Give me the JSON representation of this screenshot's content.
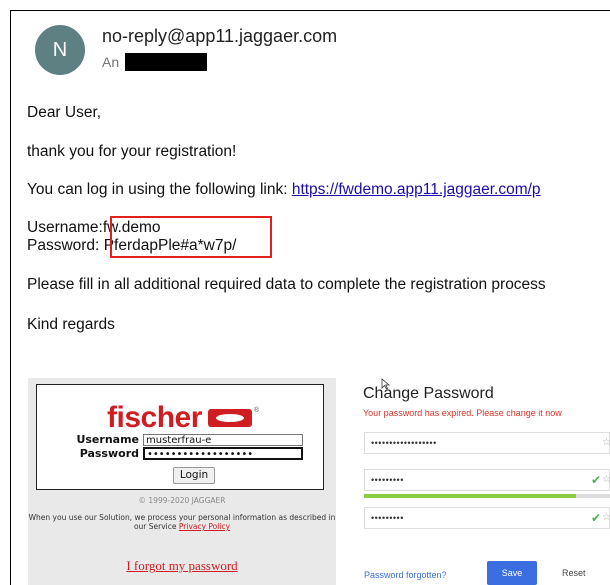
{
  "email": {
    "avatar_letter": "N",
    "sender": "no-reply@app11.jaggaer.com",
    "recipient_label": "An",
    "greeting": "Dear User,",
    "thanks": "thank you for your registration!",
    "login_intro": "You can log in using the following link: ",
    "login_link": "https://fwdemo.app11.jaggaer.com/p",
    "username_label": "Username:",
    "username_value": "fw.demo",
    "password_label": "Password:",
    "password_value": "PferdapPle#a*w7p/",
    "instructions": "Please fill in all additional required data to complete the registration process",
    "closing": "Kind regards"
  },
  "fischer_login": {
    "logo_text": "fischer",
    "logo_reg": "®",
    "username_label": "Username",
    "username_value": "musterfrau-e",
    "password_label": "Password",
    "password_value": "••••••••••••••••••",
    "login_button": "Login",
    "copyright": "© 1999-2020 JAGGAER",
    "policy_text": "When you use our Solution, we process your personal information as described in our Service ",
    "policy_link": "Privacy Policy",
    "forgot_link": "I forgot my password"
  },
  "change_password": {
    "title": "Change Password",
    "subtitle": "Your password has expired. Please change it now",
    "field1_dots": "••••••••••••••••••",
    "field2_dots": "•••••••••",
    "field3_dots": "•••••••••",
    "strength_fraction": 0.86,
    "forgot_link": "Password forgotten?",
    "save_button": "Save",
    "reset_button": "Reset"
  },
  "colors": {
    "accent_red": "#e0211b",
    "fischer_red": "#cf1d22",
    "link_blue": "#1a0dab",
    "save_blue": "#3b6ee0",
    "strength_green": "#8bcc45"
  }
}
